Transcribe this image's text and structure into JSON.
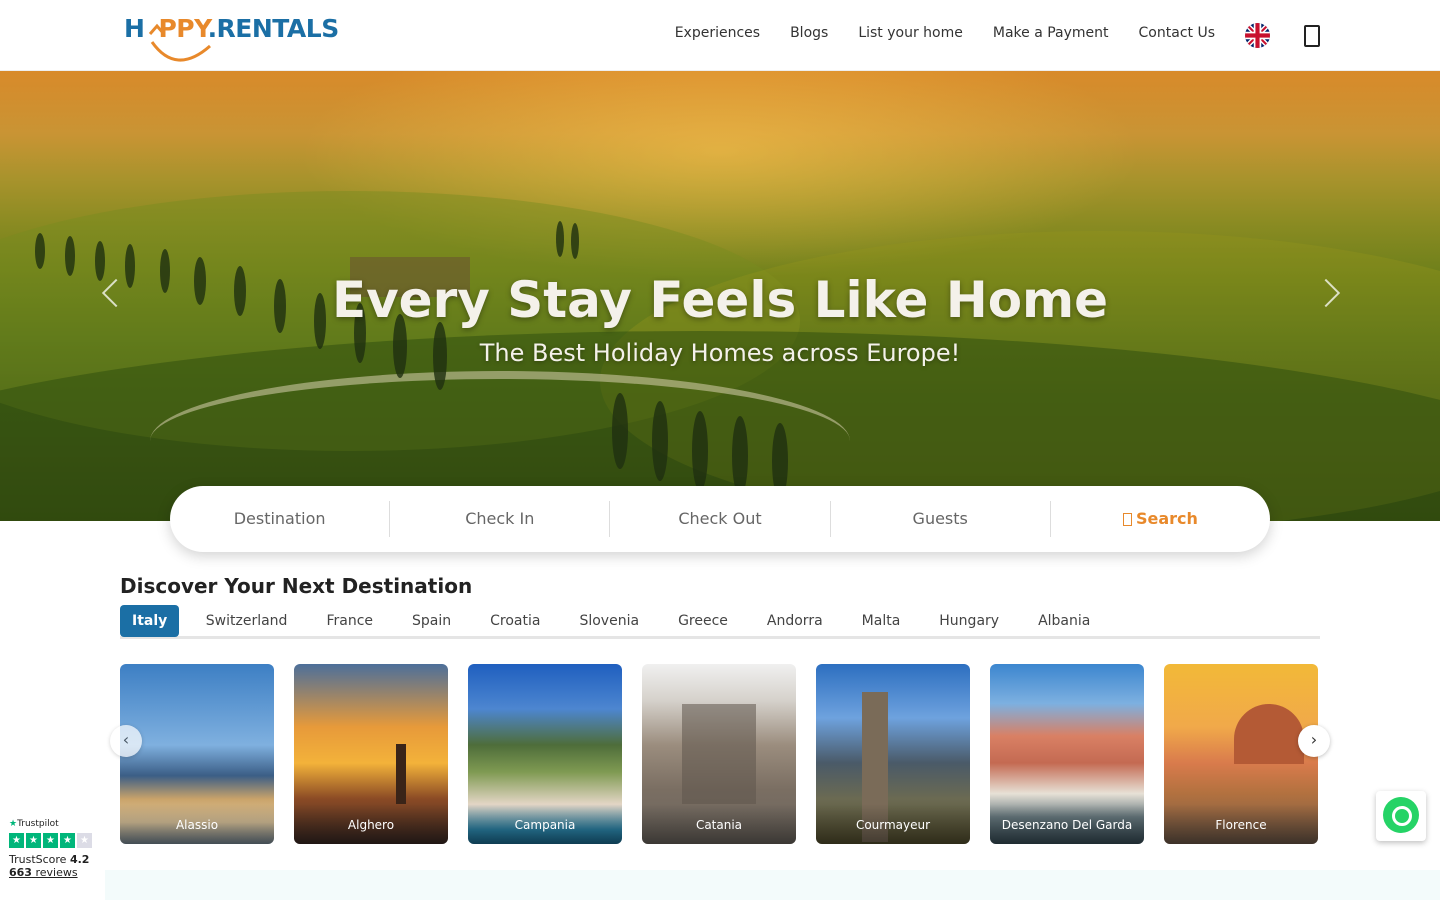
{
  "brand": {
    "logo_left": "H",
    "logo_middle": "PPY",
    "logo_right": ".RENTALS"
  },
  "nav": {
    "items": [
      "Experiences",
      "Blogs",
      "List your home",
      "Make a Payment",
      "Contact Us"
    ],
    "language_icon": "uk-flag-icon",
    "account_icon": "user-icon"
  },
  "hero": {
    "title": "Every Stay Feels Like Home",
    "subtitle": "The Best Holiday Homes across Europe!"
  },
  "search": {
    "destination": "Destination",
    "check_in": "Check In",
    "check_out": "Check Out",
    "guests": "Guests",
    "button": "Search"
  },
  "destinations": {
    "title": "Discover Your Next Destination",
    "tabs": [
      "Italy",
      "Switzerland",
      "France",
      "Spain",
      "Croatia",
      "Slovenia",
      "Greece",
      "Andorra",
      "Malta",
      "Hungary",
      "Albania"
    ],
    "active_tab": "Italy",
    "cards": [
      "Alassio",
      "Alghero",
      "Campania",
      "Catania",
      "Courmayeur",
      "Desenzano Del Garda",
      "Florence"
    ],
    "prev_icon": "chevron-left-icon",
    "next_icon": "chevron-right-icon"
  },
  "trustpilot": {
    "brand": "Trustpilot",
    "score_label": "TrustScore",
    "score": "4.2",
    "reviews_count": "663",
    "reviews_label": "reviews",
    "stars_filled": 4,
    "stars_total": 5
  },
  "colors": {
    "brand_blue": "#1b6fa5",
    "brand_orange": "#e8892b",
    "trust_green": "#00b67a",
    "whatsapp_green": "#25d366"
  }
}
